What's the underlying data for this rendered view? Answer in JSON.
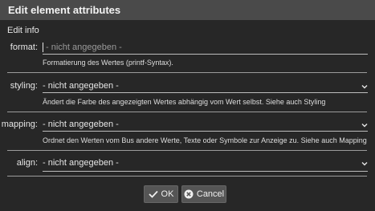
{
  "dialog": {
    "title": "Edit element attributes",
    "section_title": "Edit info"
  },
  "fields": {
    "format": {
      "label": "format:",
      "placeholder": "- nicht angegeben -",
      "hint": "Formatierung des Wertes (printf-Syntax)."
    },
    "styling": {
      "label": "styling:",
      "value": "- nicht angegeben -",
      "hint": "Ändert die Farbe des angezeigten Wertes abhängig vom Wert selbst. Siehe auch Styling"
    },
    "mapping": {
      "label": "mapping:",
      "value": "- nicht angegeben -",
      "hint": "Ordnet den Werten vom Bus andere Werte, Texte oder Symbole zur Anzeige zu. Siehe auch Mapping"
    },
    "align": {
      "label": "align:",
      "value": "- nicht angegeben -"
    }
  },
  "buttons": {
    "ok_label": "OK",
    "cancel_label": "Cancel"
  },
  "icons": {
    "dropdown": "chevron-down-icon",
    "ok": "checkmark-icon",
    "cancel": "close-circle-icon"
  }
}
